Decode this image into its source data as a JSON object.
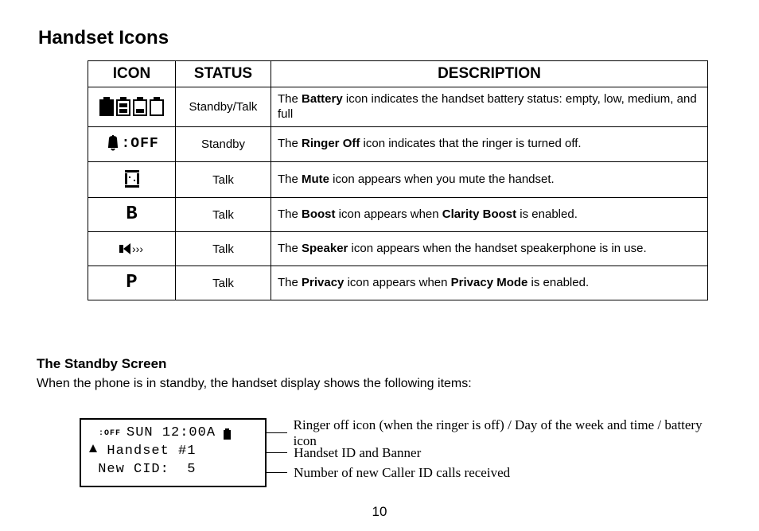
{
  "title": "Handset Icons",
  "table": {
    "headers": {
      "icon": "ICON",
      "status": "STATUS",
      "description": "DESCRIPTION"
    },
    "rows": [
      {
        "icon_name": "battery-icon",
        "status": "Standby/Talk",
        "desc_pre": "The ",
        "desc_bold1": "Battery",
        "desc_mid1": " icon indicates the handset battery status: empty, low, medium, and full",
        "desc_bold2": "",
        "desc_post": ""
      },
      {
        "icon_name": "ringer-off-icon",
        "icon_text": ":OFF",
        "status": "Standby",
        "desc_pre": "The ",
        "desc_bold1": "Ringer Off",
        "desc_mid1": " icon indicates that the ringer is turned off.",
        "desc_bold2": "",
        "desc_post": ""
      },
      {
        "icon_name": "mute-icon",
        "status": "Talk",
        "desc_pre": "The ",
        "desc_bold1": "Mute",
        "desc_mid1": " icon appears when you mute the handset.",
        "desc_bold2": "",
        "desc_post": ""
      },
      {
        "icon_name": "boost-icon",
        "icon_letter": "B",
        "status": "Talk",
        "desc_pre": "The ",
        "desc_bold1": "Boost",
        "desc_mid1": " icon appears when ",
        "desc_bold2": "Clarity Boost",
        "desc_post": " is enabled."
      },
      {
        "icon_name": "speaker-icon",
        "status": "Talk",
        "desc_pre": "The ",
        "desc_bold1": "Speaker",
        "desc_mid1": " icon appears when the handset speakerphone is in use.",
        "desc_bold2": "",
        "desc_post": ""
      },
      {
        "icon_name": "privacy-icon",
        "icon_letter": "P",
        "status": "Talk",
        "desc_pre": "The ",
        "desc_bold1": "Privacy",
        "desc_mid1": " icon appears when ",
        "desc_bold2": "Privacy Mode",
        "desc_post": " is enabled."
      }
    ]
  },
  "standby": {
    "heading": "The Standby Screen",
    "intro": "When the phone is in standby, the handset display shows the following items:",
    "lcd": {
      "line1_off": ":OFF ",
      "line1_daytime": "SUN 12:00A",
      "line2": "  Handset #1",
      "line3": " New CID:  5"
    },
    "callouts": [
      "Ringer off icon (when the ringer is off) / Day of the week and time / battery icon",
      "Handset ID and Banner",
      "Number of new Caller ID calls received"
    ]
  },
  "page_number": "10"
}
